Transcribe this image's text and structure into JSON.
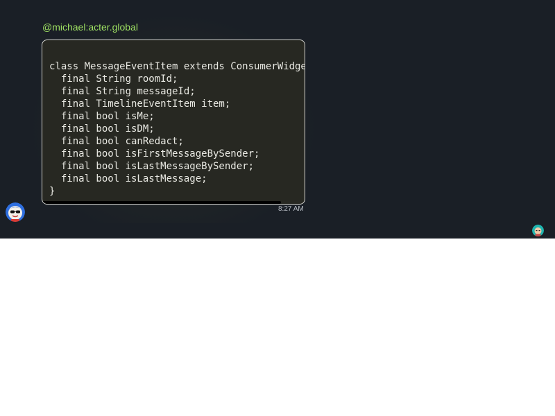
{
  "message": {
    "sender": "@michael:acter.global",
    "code_lines": [
      "class MessageEventItem extends ConsumerWidget {",
      "  final String roomId;",
      "  final String messageId;",
      "  final TimelineEventItem item;",
      "  final bool isMe;",
      "  final bool isDM;",
      "  final bool canRedact;",
      "  final bool isFirstMessageBySender;",
      "  final bool isLastMessageBySender;",
      "  final bool isLastMessage;",
      "}"
    ],
    "timestamp": "8:27 AM",
    "code_scroll_fraction": 0.91
  },
  "avatars": {
    "sender_avatar_icon": "avatar-sunglasses-icon",
    "read_receipt_icon": "avatar-reader-icon"
  },
  "colors": {
    "chat_background": "#1a1f26",
    "sender_name": "#9ee062",
    "code_background": "#272822",
    "code_text": "#e8e8e2",
    "timestamp": "#b7bcc3"
  }
}
